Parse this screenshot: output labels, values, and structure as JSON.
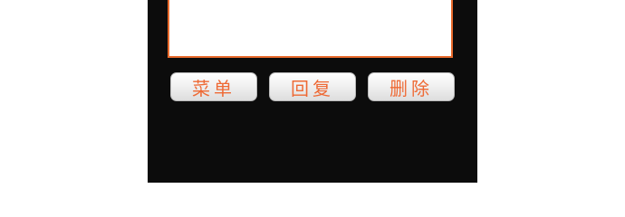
{
  "softkeys": {
    "menu_label": "菜单",
    "reply_label": "回复",
    "delete_label": "删除"
  },
  "colors": {
    "screen_background": "#0c0c0c",
    "accent": "#ee6a35",
    "message_border": "#e86a2c"
  }
}
